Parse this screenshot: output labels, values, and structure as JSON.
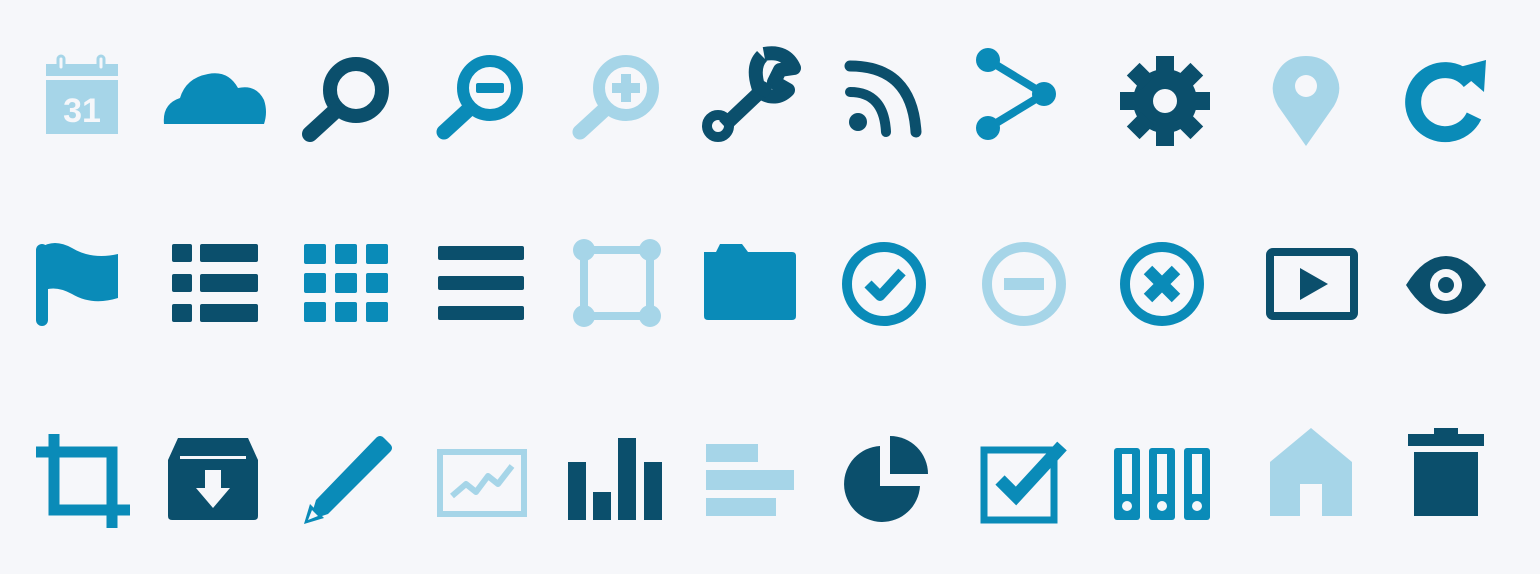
{
  "colors": {
    "dark": "#0b4f6c",
    "mid": "#0a8bb8",
    "light": "#a6d5e8",
    "background": "#f6f7fa"
  },
  "calendar": {
    "day": "31"
  },
  "icons": [
    "calendar-icon",
    "cloud-icon",
    "search-icon",
    "zoom-out-icon",
    "zoom-in-icon",
    "wrench-icon",
    "rss-icon",
    "share-icon",
    "gear-icon",
    "location-pin-icon",
    "refresh-icon",
    "flag-icon",
    "list-icon",
    "grid-icon",
    "menu-icon",
    "selection-icon",
    "folder-icon",
    "check-circle-icon",
    "minus-circle-icon",
    "close-circle-icon",
    "video-play-icon",
    "eye-icon",
    "crop-icon",
    "archive-download-icon",
    "pencil-icon",
    "line-chart-icon",
    "bar-chart-icon",
    "horizontal-bars-icon",
    "pie-chart-icon",
    "checkbox-checked-icon",
    "binders-icon",
    "home-icon",
    "trash-icon"
  ]
}
